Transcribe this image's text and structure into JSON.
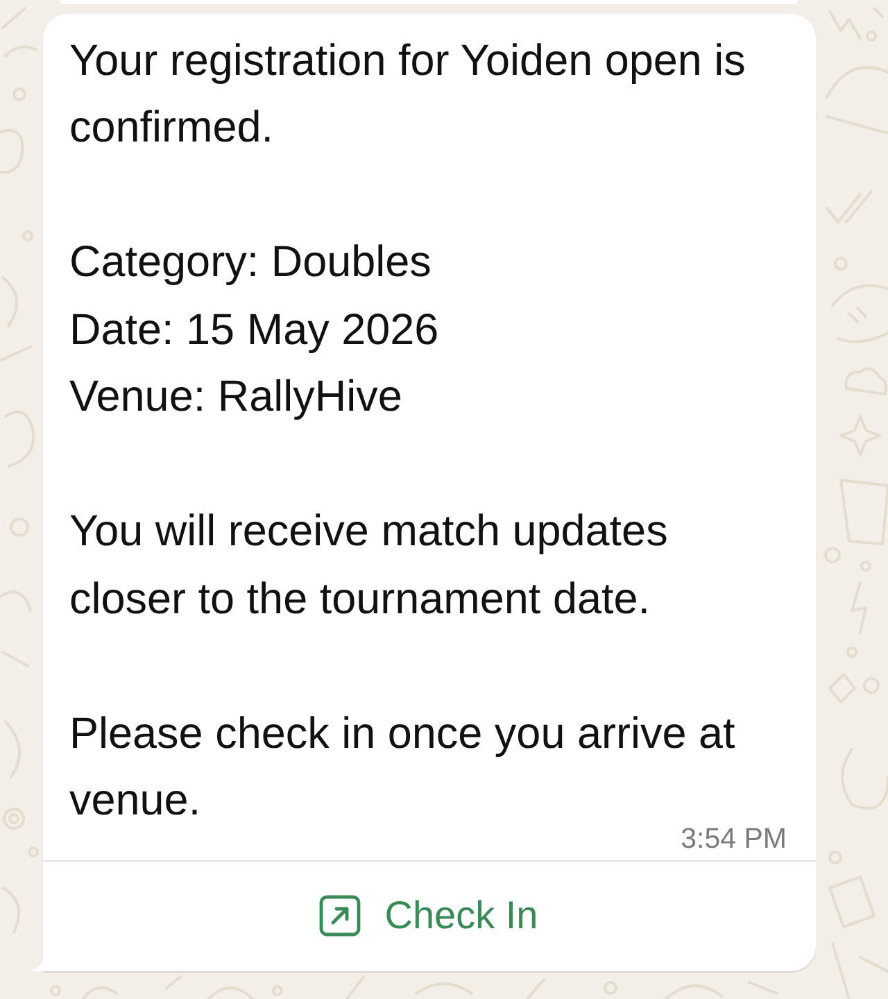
{
  "message": {
    "paragraphs": [
      {
        "lines": [
          "Your registration for Yoiden open is confirmed."
        ]
      },
      {
        "lines": [
          "Category: Doubles",
          "Date: 15 May 2026",
          "Venue: RallyHive"
        ]
      },
      {
        "lines": [
          "You will receive match updates closer to the tournament date."
        ]
      },
      {
        "lines": [
          "Please check in once you arrive at venue."
        ]
      }
    ],
    "time": "3:54 PM",
    "actions": [
      {
        "label": "Check In",
        "kind": "link"
      }
    ]
  }
}
